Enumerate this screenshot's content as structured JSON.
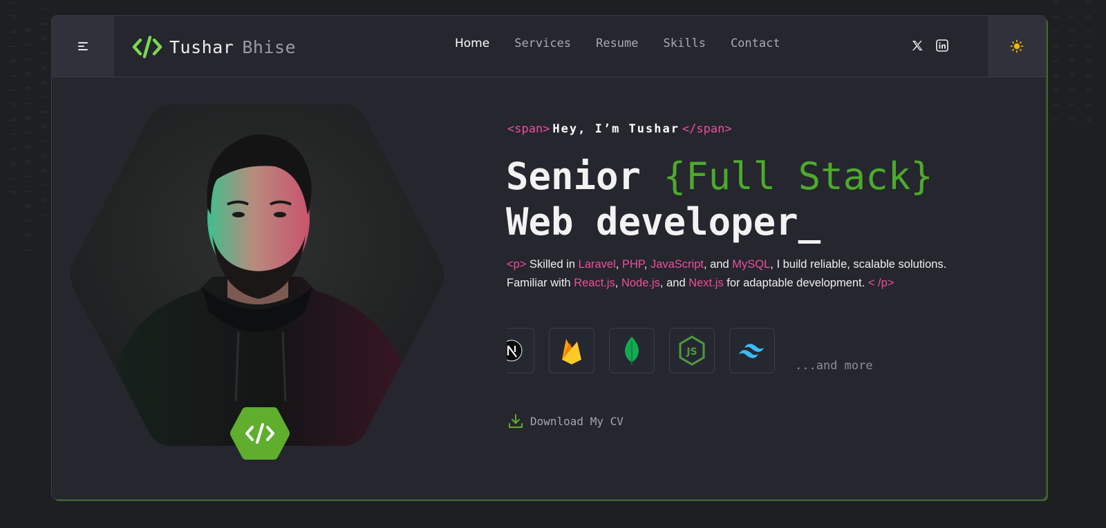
{
  "brand": {
    "first_name": "Tushar",
    "last_name": "Bhise"
  },
  "nav": {
    "items": [
      {
        "label": "Home",
        "active": true
      },
      {
        "label": "Services"
      },
      {
        "label": "Resume"
      },
      {
        "label": "Skills"
      },
      {
        "label": "Contact"
      }
    ]
  },
  "social": {
    "links": [
      "x-icon",
      "linkedin-icon"
    ]
  },
  "theme_toggle": {
    "icon": "sun-icon"
  },
  "hero": {
    "tag_open": "<span>",
    "greeting": "Hey, I’m Tushar",
    "tag_close": "</span>",
    "headline_word1": "Senior",
    "headline_highlight": "{Full Stack}",
    "headline_line2": "Web developer_",
    "desc": {
      "p_open": "<p>",
      "t1": " Skilled in ",
      "laravel": "Laravel",
      "c1": ", ",
      "php": "PHP",
      "c2": ", ",
      "js": "JavaScript",
      "and1": ", and ",
      "mysql": "MySQL",
      "t2": ", I build reliable, scalable solutions. Familiar with ",
      "react": "React.js",
      "c3": ", ",
      "node": "Node.js",
      "and2": ", and ",
      "next": "Next.js",
      "t3": " for adaptable development. ",
      "p_close": "< /p>"
    },
    "tech_icons": [
      "nextjs-icon",
      "firebase-icon",
      "mongodb-icon",
      "nodejs-icon",
      "tailwind-icon"
    ],
    "more_label": "...and more",
    "download_label": "Download My CV"
  },
  "colors": {
    "accent_green": "#4caa2c",
    "accent_pink": "#ef4f9d",
    "sun": "#f5b40a",
    "background": "#1d1f23",
    "card": "#25262e"
  }
}
